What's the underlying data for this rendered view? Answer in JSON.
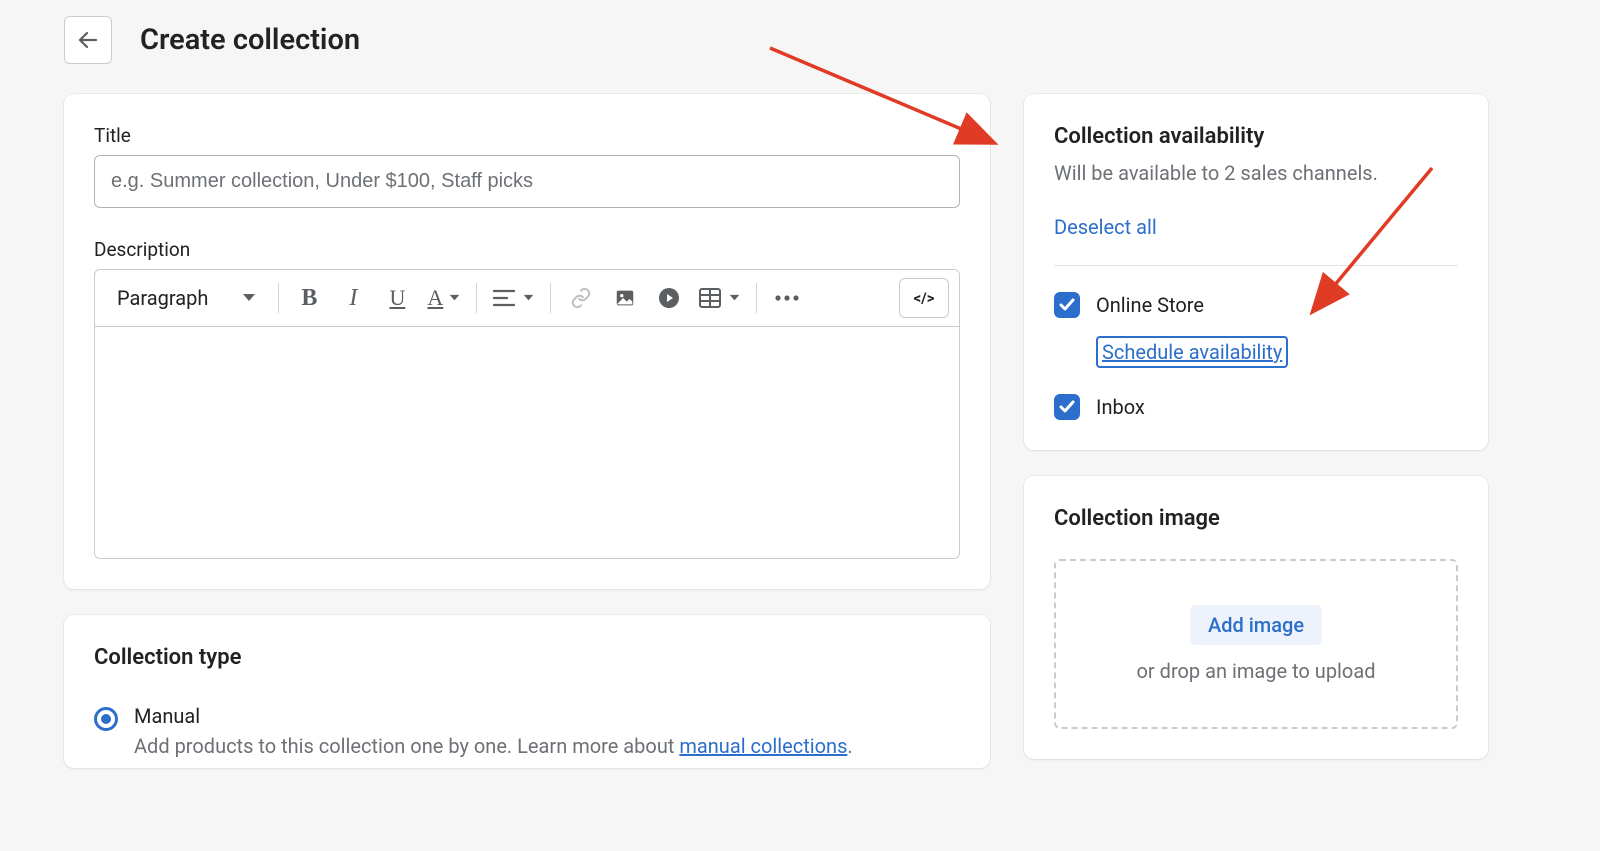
{
  "header": {
    "title": "Create collection"
  },
  "main": {
    "title_field": {
      "label": "Title",
      "placeholder": "e.g. Summer collection, Under $100, Staff picks"
    },
    "description_field": {
      "label": "Description",
      "format_label": "Paragraph",
      "source_label": "</>"
    },
    "collection_type": {
      "heading": "Collection type",
      "options": [
        {
          "label": "Manual",
          "help_prefix": "Add products to this collection one by one. Learn more about ",
          "help_link": "manual collections",
          "help_suffix": ".",
          "selected": true
        }
      ]
    }
  },
  "sidebar": {
    "availability": {
      "heading": "Collection availability",
      "sub": "Will be available to 2 sales channels.",
      "deselect_label": "Deselect all",
      "channels": [
        {
          "label": "Online Store",
          "checked": true,
          "schedule_label": "Schedule availability"
        },
        {
          "label": "Inbox",
          "checked": true
        }
      ]
    },
    "image": {
      "heading": "Collection image",
      "add_label": "Add image",
      "drop_help": "or drop an image to upload"
    }
  }
}
